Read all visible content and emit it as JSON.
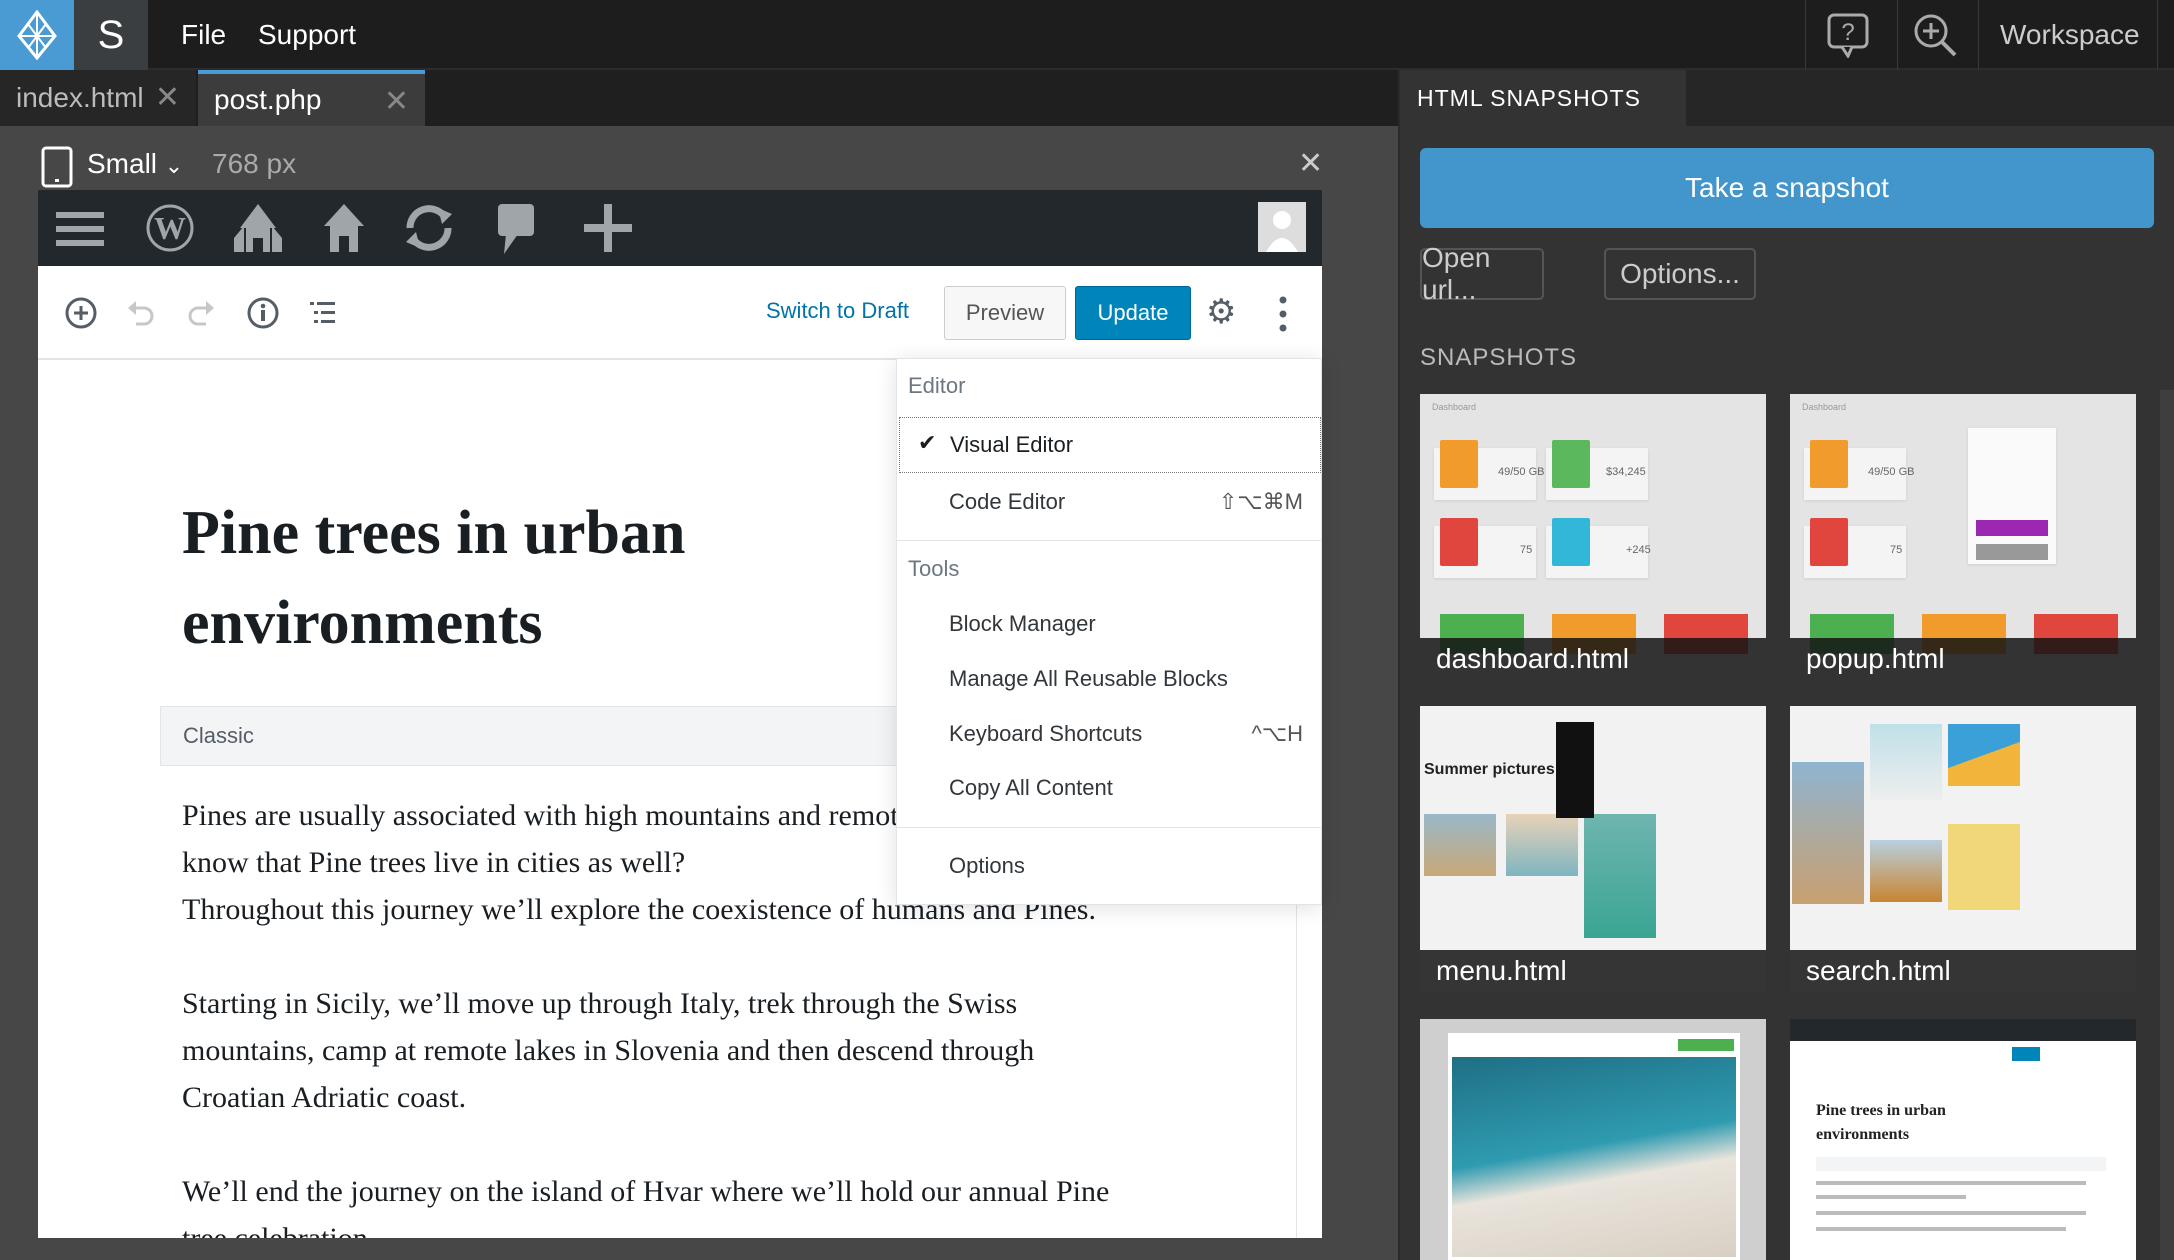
{
  "app": {
    "logo_letter": "S",
    "menu": [
      "File",
      "Support"
    ],
    "workspace_label": "Workspace"
  },
  "tabs": [
    {
      "label": "index.html",
      "active": false
    },
    {
      "label": "post.php",
      "active": true
    }
  ],
  "device": {
    "size_label": "Small",
    "width_label": "768 px"
  },
  "editor_toolbar": {
    "switch_to_draft": "Switch to Draft",
    "preview": "Preview",
    "update": "Update"
  },
  "post": {
    "title": "Pine trees in urban environments",
    "classic_block_label": "Classic",
    "paragraphs": [
      "Pines are usually associated with high mountains and remote lakes. But did you know that Pine trees live in cities as well?",
      "Throughout this journey we’ll explore the coexistence of humans and Pines.",
      "Starting in Sicily, we’ll move up through Italy, trek through the Swiss mountains, camp at remote lakes in Slovenia and then descend through Croatian Adriatic coast.",
      "We’ll end the journey on the island of Hvar where we’ll hold our annual Pine tree celebration."
    ]
  },
  "dropdown": {
    "editor_heading": "Editor",
    "visual_editor": "Visual Editor",
    "code_editor": "Code Editor",
    "code_editor_shortcut": "⇧⌥⌘M",
    "tools_heading": "Tools",
    "block_manager": "Block Manager",
    "manage_reusable": "Manage All Reusable Blocks",
    "keyboard_shortcuts": "Keyboard Shortcuts",
    "keyboard_shortcuts_shortcut": "^⌥H",
    "copy_all": "Copy All Content",
    "options": "Options"
  },
  "panel": {
    "tab_label": "HTML SNAPSHOTS",
    "take_snapshot": "Take a snapshot",
    "open_url": "Open url...",
    "options": "Options...",
    "snapshots_heading": "SNAPSHOTS",
    "snapshots": [
      {
        "label": "dashboard.html",
        "title": "Dashboard",
        "stats": [
          "49/50 GB",
          "$34,245",
          "75",
          "+245"
        ]
      },
      {
        "label": "popup.html",
        "title": "Dashboard",
        "stats": [
          "49/50 GB",
          "75"
        ]
      },
      {
        "label": "menu.html",
        "heading": "Summer pictures"
      },
      {
        "label": "search.html"
      },
      {
        "label": ""
      },
      {
        "label": "",
        "title": "Pine trees in urban environments"
      }
    ]
  },
  "colors": {
    "accent": "#4396cb",
    "wp_update": "#0085ba",
    "wp_bar": "#23282d",
    "link": "#0073aa"
  }
}
